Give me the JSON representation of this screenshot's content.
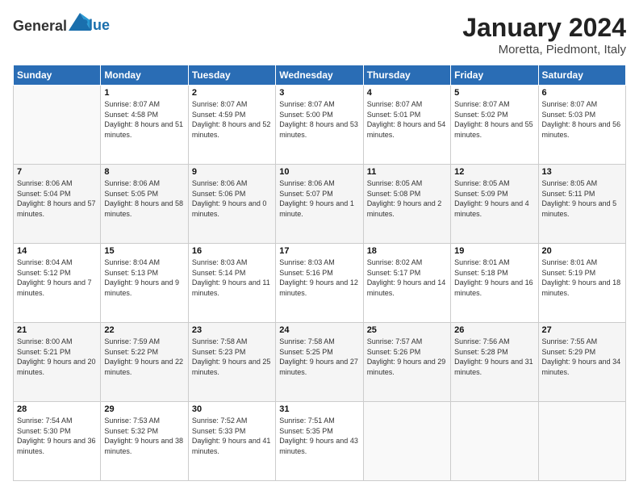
{
  "logo": {
    "text_general": "General",
    "text_blue": "Blue"
  },
  "header": {
    "month": "January 2024",
    "location": "Moretta, Piedmont, Italy"
  },
  "weekdays": [
    "Sunday",
    "Monday",
    "Tuesday",
    "Wednesday",
    "Thursday",
    "Friday",
    "Saturday"
  ],
  "weeks": [
    [
      {
        "day": "",
        "sunrise": "",
        "sunset": "",
        "daylight": ""
      },
      {
        "day": "1",
        "sunrise": "Sunrise: 8:07 AM",
        "sunset": "Sunset: 4:58 PM",
        "daylight": "Daylight: 8 hours and 51 minutes."
      },
      {
        "day": "2",
        "sunrise": "Sunrise: 8:07 AM",
        "sunset": "Sunset: 4:59 PM",
        "daylight": "Daylight: 8 hours and 52 minutes."
      },
      {
        "day": "3",
        "sunrise": "Sunrise: 8:07 AM",
        "sunset": "Sunset: 5:00 PM",
        "daylight": "Daylight: 8 hours and 53 minutes."
      },
      {
        "day": "4",
        "sunrise": "Sunrise: 8:07 AM",
        "sunset": "Sunset: 5:01 PM",
        "daylight": "Daylight: 8 hours and 54 minutes."
      },
      {
        "day": "5",
        "sunrise": "Sunrise: 8:07 AM",
        "sunset": "Sunset: 5:02 PM",
        "daylight": "Daylight: 8 hours and 55 minutes."
      },
      {
        "day": "6",
        "sunrise": "Sunrise: 8:07 AM",
        "sunset": "Sunset: 5:03 PM",
        "daylight": "Daylight: 8 hours and 56 minutes."
      }
    ],
    [
      {
        "day": "7",
        "sunrise": "Sunrise: 8:06 AM",
        "sunset": "Sunset: 5:04 PM",
        "daylight": "Daylight: 8 hours and 57 minutes."
      },
      {
        "day": "8",
        "sunrise": "Sunrise: 8:06 AM",
        "sunset": "Sunset: 5:05 PM",
        "daylight": "Daylight: 8 hours and 58 minutes."
      },
      {
        "day": "9",
        "sunrise": "Sunrise: 8:06 AM",
        "sunset": "Sunset: 5:06 PM",
        "daylight": "Daylight: 9 hours and 0 minutes."
      },
      {
        "day": "10",
        "sunrise": "Sunrise: 8:06 AM",
        "sunset": "Sunset: 5:07 PM",
        "daylight": "Daylight: 9 hours and 1 minute."
      },
      {
        "day": "11",
        "sunrise": "Sunrise: 8:05 AM",
        "sunset": "Sunset: 5:08 PM",
        "daylight": "Daylight: 9 hours and 2 minutes."
      },
      {
        "day": "12",
        "sunrise": "Sunrise: 8:05 AM",
        "sunset": "Sunset: 5:09 PM",
        "daylight": "Daylight: 9 hours and 4 minutes."
      },
      {
        "day": "13",
        "sunrise": "Sunrise: 8:05 AM",
        "sunset": "Sunset: 5:11 PM",
        "daylight": "Daylight: 9 hours and 5 minutes."
      }
    ],
    [
      {
        "day": "14",
        "sunrise": "Sunrise: 8:04 AM",
        "sunset": "Sunset: 5:12 PM",
        "daylight": "Daylight: 9 hours and 7 minutes."
      },
      {
        "day": "15",
        "sunrise": "Sunrise: 8:04 AM",
        "sunset": "Sunset: 5:13 PM",
        "daylight": "Daylight: 9 hours and 9 minutes."
      },
      {
        "day": "16",
        "sunrise": "Sunrise: 8:03 AM",
        "sunset": "Sunset: 5:14 PM",
        "daylight": "Daylight: 9 hours and 11 minutes."
      },
      {
        "day": "17",
        "sunrise": "Sunrise: 8:03 AM",
        "sunset": "Sunset: 5:16 PM",
        "daylight": "Daylight: 9 hours and 12 minutes."
      },
      {
        "day": "18",
        "sunrise": "Sunrise: 8:02 AM",
        "sunset": "Sunset: 5:17 PM",
        "daylight": "Daylight: 9 hours and 14 minutes."
      },
      {
        "day": "19",
        "sunrise": "Sunrise: 8:01 AM",
        "sunset": "Sunset: 5:18 PM",
        "daylight": "Daylight: 9 hours and 16 minutes."
      },
      {
        "day": "20",
        "sunrise": "Sunrise: 8:01 AM",
        "sunset": "Sunset: 5:19 PM",
        "daylight": "Daylight: 9 hours and 18 minutes."
      }
    ],
    [
      {
        "day": "21",
        "sunrise": "Sunrise: 8:00 AM",
        "sunset": "Sunset: 5:21 PM",
        "daylight": "Daylight: 9 hours and 20 minutes."
      },
      {
        "day": "22",
        "sunrise": "Sunrise: 7:59 AM",
        "sunset": "Sunset: 5:22 PM",
        "daylight": "Daylight: 9 hours and 22 minutes."
      },
      {
        "day": "23",
        "sunrise": "Sunrise: 7:58 AM",
        "sunset": "Sunset: 5:23 PM",
        "daylight": "Daylight: 9 hours and 25 minutes."
      },
      {
        "day": "24",
        "sunrise": "Sunrise: 7:58 AM",
        "sunset": "Sunset: 5:25 PM",
        "daylight": "Daylight: 9 hours and 27 minutes."
      },
      {
        "day": "25",
        "sunrise": "Sunrise: 7:57 AM",
        "sunset": "Sunset: 5:26 PM",
        "daylight": "Daylight: 9 hours and 29 minutes."
      },
      {
        "day": "26",
        "sunrise": "Sunrise: 7:56 AM",
        "sunset": "Sunset: 5:28 PM",
        "daylight": "Daylight: 9 hours and 31 minutes."
      },
      {
        "day": "27",
        "sunrise": "Sunrise: 7:55 AM",
        "sunset": "Sunset: 5:29 PM",
        "daylight": "Daylight: 9 hours and 34 minutes."
      }
    ],
    [
      {
        "day": "28",
        "sunrise": "Sunrise: 7:54 AM",
        "sunset": "Sunset: 5:30 PM",
        "daylight": "Daylight: 9 hours and 36 minutes."
      },
      {
        "day": "29",
        "sunrise": "Sunrise: 7:53 AM",
        "sunset": "Sunset: 5:32 PM",
        "daylight": "Daylight: 9 hours and 38 minutes."
      },
      {
        "day": "30",
        "sunrise": "Sunrise: 7:52 AM",
        "sunset": "Sunset: 5:33 PM",
        "daylight": "Daylight: 9 hours and 41 minutes."
      },
      {
        "day": "31",
        "sunrise": "Sunrise: 7:51 AM",
        "sunset": "Sunset: 5:35 PM",
        "daylight": "Daylight: 9 hours and 43 minutes."
      },
      {
        "day": "",
        "sunrise": "",
        "sunset": "",
        "daylight": ""
      },
      {
        "day": "",
        "sunrise": "",
        "sunset": "",
        "daylight": ""
      },
      {
        "day": "",
        "sunrise": "",
        "sunset": "",
        "daylight": ""
      }
    ]
  ]
}
